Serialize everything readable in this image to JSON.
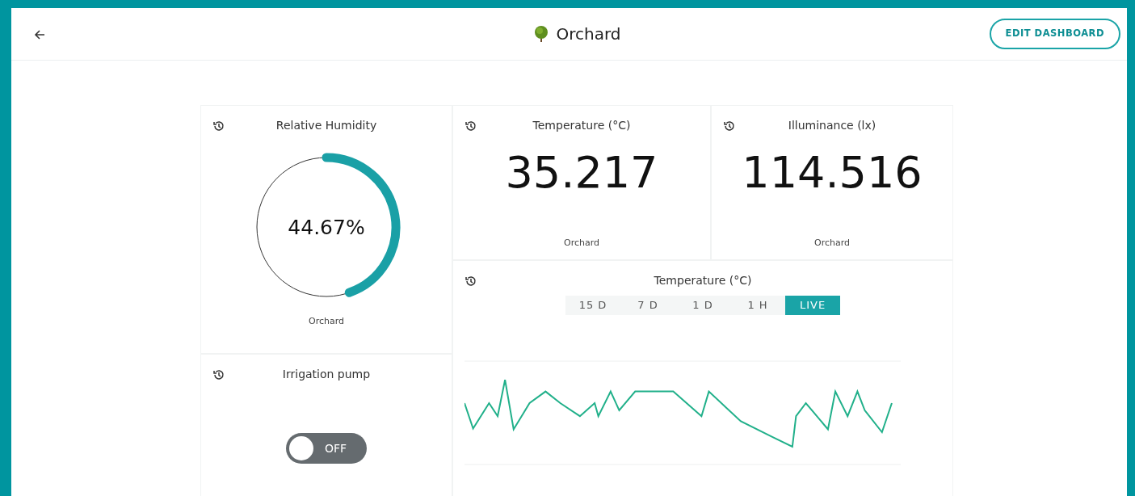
{
  "header": {
    "title": "Orchard",
    "edit_button": "EDIT DASHBOARD"
  },
  "widgets": [
    {
      "kind": "gauge",
      "title": "Relative Humidity",
      "reading": "44.67%",
      "device": "Orchard"
    },
    {
      "kind": "value",
      "title": "Temperature (°C)",
      "reading": "35.217",
      "device": "Orchard"
    },
    {
      "kind": "value",
      "title": "Illuminance (lx)",
      "reading": "114.516",
      "device": "Orchard"
    },
    {
      "kind": "switch",
      "title": "Irrigation pump",
      "on": false,
      "label": "OFF"
    },
    {
      "kind": "chart",
      "title": "Temperature (°C)",
      "ranges": [
        {
          "label": "15 D",
          "selected": false
        },
        {
          "label": "7 D",
          "selected": false
        },
        {
          "label": "1 D",
          "selected": false
        },
        {
          "label": "1 H",
          "selected": false
        },
        {
          "label": "LIVE",
          "selected": true
        }
      ]
    }
  ]
}
